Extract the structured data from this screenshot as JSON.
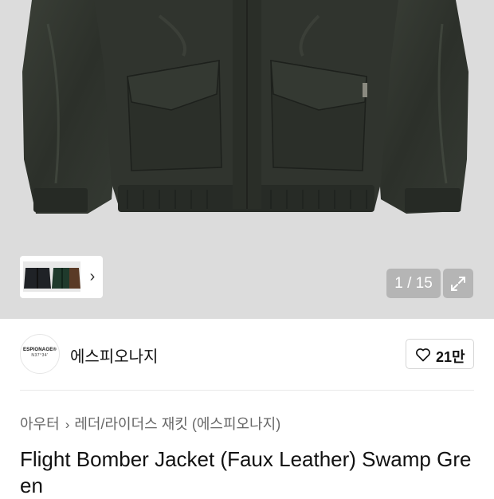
{
  "gallery": {
    "counter": "1 / 15",
    "thumbnails": [
      "black-jacket",
      "green-jacket",
      "brown-jacket"
    ],
    "colors": {
      "background": "#dcdcdc",
      "jacket": "#2f332d"
    }
  },
  "brand": {
    "logo_line1": "ESPIONAGE®",
    "logo_line2": "N37°34'",
    "name": "에스피오나지",
    "like_count": "21만"
  },
  "breadcrumb": {
    "category": "아우터",
    "subcategory": "레더/라이더스 재킷 (에스피오나지)"
  },
  "product": {
    "title": "Flight Bomber Jacket (Faux Leather) Swamp Green"
  }
}
